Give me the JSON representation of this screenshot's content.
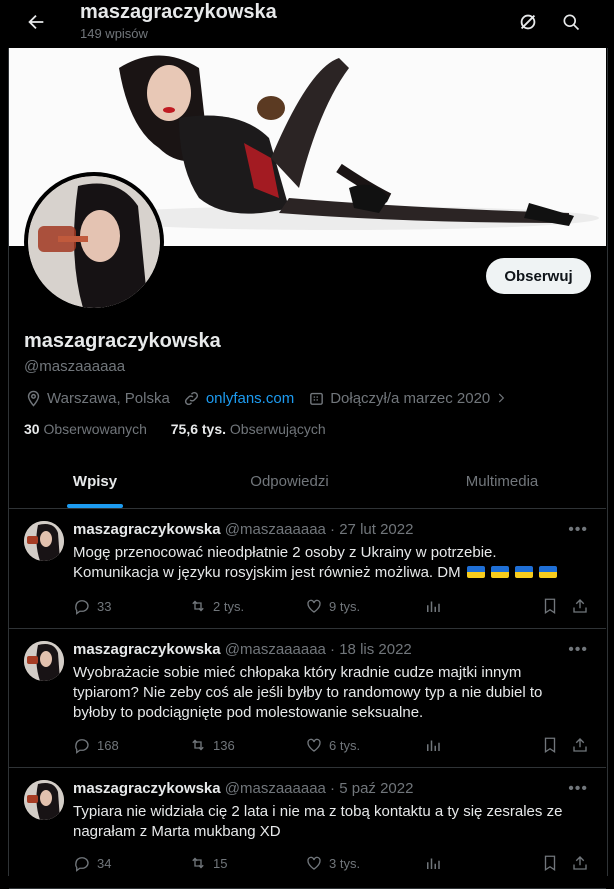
{
  "header": {
    "title": "maszagraczykowska",
    "post_count": "149 wpisów"
  },
  "profile": {
    "follow_label": "Obserwuj",
    "display_name": "maszagraczykowska",
    "handle": "@maszaaaaaa",
    "location": "Warszawa, Polska",
    "link": "onlyfans.com",
    "joined": "Dołączył/a marzec 2020",
    "following_count": "30",
    "following_label": "Obserwowanych",
    "followers_count": "75,6 tys.",
    "followers_label": "Obserwujących"
  },
  "tabs": [
    {
      "label": "Wpisy"
    },
    {
      "label": "Odpowiedzi"
    },
    {
      "label": "Multimedia"
    }
  ],
  "tweets": [
    {
      "name": "maszagraczykowska",
      "handle_date": "@maszaaaaaa · 27 lut 2022",
      "text": "Mogę przenocować nieodpłatnie 2 osoby z Ukrainy w potrzebie. Komunikacja w języku rosyjskim jest również możliwa. DM",
      "replies": "33",
      "retweets": "2 tys.",
      "likes": "9 tys."
    },
    {
      "name": "maszagraczykowska",
      "handle_date": "@maszaaaaaa · 18 lis 2022",
      "text": "Wyobrażacie sobie mieć chłopaka który kradnie cudze majtki innym typiarom? Nie zeby coś ale jeśli byłby to randomowy typ a nie dubiel to byłoby to podciągnięte pod molestowanie seksualne.",
      "replies": "168",
      "retweets": "136",
      "likes": "6 tys."
    },
    {
      "name": "maszagraczykowska",
      "handle_date": "@maszaaaaaa · 5 paź 2022",
      "text": "Typiara nie widziała cię 2 lata i nie ma z tobą kontaktu a ty się zesrales ze nagrałam z Marta mukbang XD",
      "replies": "34",
      "retweets": "15",
      "likes": "3 tys."
    }
  ],
  "colors": {
    "accent": "#1d9bf0",
    "background": "#000000",
    "muted": "#71767b",
    "flag_blue": "#1f6fd6",
    "flag_yellow": "#f7cc1d"
  }
}
